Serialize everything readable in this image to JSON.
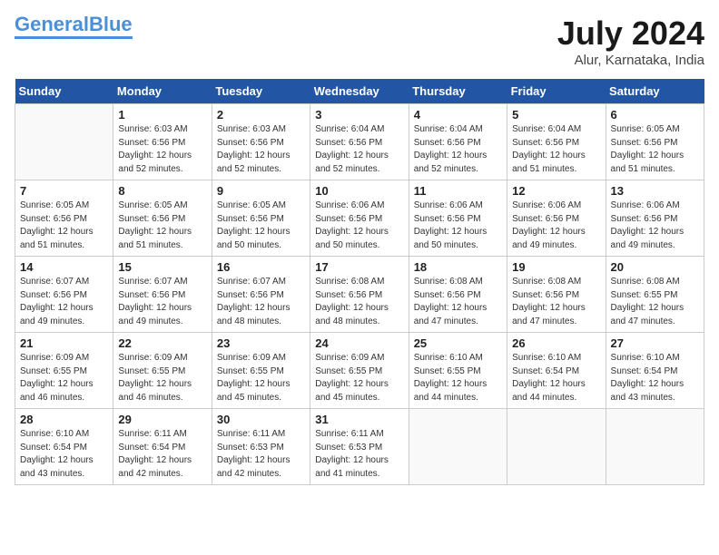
{
  "header": {
    "logo_general": "General",
    "logo_blue": "Blue",
    "month_year": "July 2024",
    "location": "Alur, Karnataka, India"
  },
  "weekdays": [
    "Sunday",
    "Monday",
    "Tuesday",
    "Wednesday",
    "Thursday",
    "Friday",
    "Saturday"
  ],
  "weeks": [
    [
      {
        "day": "",
        "sunrise": "",
        "sunset": "",
        "daylight": ""
      },
      {
        "day": "1",
        "sunrise": "Sunrise: 6:03 AM",
        "sunset": "Sunset: 6:56 PM",
        "daylight": "Daylight: 12 hours and 52 minutes."
      },
      {
        "day": "2",
        "sunrise": "Sunrise: 6:03 AM",
        "sunset": "Sunset: 6:56 PM",
        "daylight": "Daylight: 12 hours and 52 minutes."
      },
      {
        "day": "3",
        "sunrise": "Sunrise: 6:04 AM",
        "sunset": "Sunset: 6:56 PM",
        "daylight": "Daylight: 12 hours and 52 minutes."
      },
      {
        "day": "4",
        "sunrise": "Sunrise: 6:04 AM",
        "sunset": "Sunset: 6:56 PM",
        "daylight": "Daylight: 12 hours and 52 minutes."
      },
      {
        "day": "5",
        "sunrise": "Sunrise: 6:04 AM",
        "sunset": "Sunset: 6:56 PM",
        "daylight": "Daylight: 12 hours and 51 minutes."
      },
      {
        "day": "6",
        "sunrise": "Sunrise: 6:05 AM",
        "sunset": "Sunset: 6:56 PM",
        "daylight": "Daylight: 12 hours and 51 minutes."
      }
    ],
    [
      {
        "day": "7",
        "sunrise": "Sunrise: 6:05 AM",
        "sunset": "Sunset: 6:56 PM",
        "daylight": "Daylight: 12 hours and 51 minutes."
      },
      {
        "day": "8",
        "sunrise": "Sunrise: 6:05 AM",
        "sunset": "Sunset: 6:56 PM",
        "daylight": "Daylight: 12 hours and 51 minutes."
      },
      {
        "day": "9",
        "sunrise": "Sunrise: 6:05 AM",
        "sunset": "Sunset: 6:56 PM",
        "daylight": "Daylight: 12 hours and 50 minutes."
      },
      {
        "day": "10",
        "sunrise": "Sunrise: 6:06 AM",
        "sunset": "Sunset: 6:56 PM",
        "daylight": "Daylight: 12 hours and 50 minutes."
      },
      {
        "day": "11",
        "sunrise": "Sunrise: 6:06 AM",
        "sunset": "Sunset: 6:56 PM",
        "daylight": "Daylight: 12 hours and 50 minutes."
      },
      {
        "day": "12",
        "sunrise": "Sunrise: 6:06 AM",
        "sunset": "Sunset: 6:56 PM",
        "daylight": "Daylight: 12 hours and 49 minutes."
      },
      {
        "day": "13",
        "sunrise": "Sunrise: 6:06 AM",
        "sunset": "Sunset: 6:56 PM",
        "daylight": "Daylight: 12 hours and 49 minutes."
      }
    ],
    [
      {
        "day": "14",
        "sunrise": "Sunrise: 6:07 AM",
        "sunset": "Sunset: 6:56 PM",
        "daylight": "Daylight: 12 hours and 49 minutes."
      },
      {
        "day": "15",
        "sunrise": "Sunrise: 6:07 AM",
        "sunset": "Sunset: 6:56 PM",
        "daylight": "Daylight: 12 hours and 49 minutes."
      },
      {
        "day": "16",
        "sunrise": "Sunrise: 6:07 AM",
        "sunset": "Sunset: 6:56 PM",
        "daylight": "Daylight: 12 hours and 48 minutes."
      },
      {
        "day": "17",
        "sunrise": "Sunrise: 6:08 AM",
        "sunset": "Sunset: 6:56 PM",
        "daylight": "Daylight: 12 hours and 48 minutes."
      },
      {
        "day": "18",
        "sunrise": "Sunrise: 6:08 AM",
        "sunset": "Sunset: 6:56 PM",
        "daylight": "Daylight: 12 hours and 47 minutes."
      },
      {
        "day": "19",
        "sunrise": "Sunrise: 6:08 AM",
        "sunset": "Sunset: 6:56 PM",
        "daylight": "Daylight: 12 hours and 47 minutes."
      },
      {
        "day": "20",
        "sunrise": "Sunrise: 6:08 AM",
        "sunset": "Sunset: 6:55 PM",
        "daylight": "Daylight: 12 hours and 47 minutes."
      }
    ],
    [
      {
        "day": "21",
        "sunrise": "Sunrise: 6:09 AM",
        "sunset": "Sunset: 6:55 PM",
        "daylight": "Daylight: 12 hours and 46 minutes."
      },
      {
        "day": "22",
        "sunrise": "Sunrise: 6:09 AM",
        "sunset": "Sunset: 6:55 PM",
        "daylight": "Daylight: 12 hours and 46 minutes."
      },
      {
        "day": "23",
        "sunrise": "Sunrise: 6:09 AM",
        "sunset": "Sunset: 6:55 PM",
        "daylight": "Daylight: 12 hours and 45 minutes."
      },
      {
        "day": "24",
        "sunrise": "Sunrise: 6:09 AM",
        "sunset": "Sunset: 6:55 PM",
        "daylight": "Daylight: 12 hours and 45 minutes."
      },
      {
        "day": "25",
        "sunrise": "Sunrise: 6:10 AM",
        "sunset": "Sunset: 6:55 PM",
        "daylight": "Daylight: 12 hours and 44 minutes."
      },
      {
        "day": "26",
        "sunrise": "Sunrise: 6:10 AM",
        "sunset": "Sunset: 6:54 PM",
        "daylight": "Daylight: 12 hours and 44 minutes."
      },
      {
        "day": "27",
        "sunrise": "Sunrise: 6:10 AM",
        "sunset": "Sunset: 6:54 PM",
        "daylight": "Daylight: 12 hours and 43 minutes."
      }
    ],
    [
      {
        "day": "28",
        "sunrise": "Sunrise: 6:10 AM",
        "sunset": "Sunset: 6:54 PM",
        "daylight": "Daylight: 12 hours and 43 minutes."
      },
      {
        "day": "29",
        "sunrise": "Sunrise: 6:11 AM",
        "sunset": "Sunset: 6:54 PM",
        "daylight": "Daylight: 12 hours and 42 minutes."
      },
      {
        "day": "30",
        "sunrise": "Sunrise: 6:11 AM",
        "sunset": "Sunset: 6:53 PM",
        "daylight": "Daylight: 12 hours and 42 minutes."
      },
      {
        "day": "31",
        "sunrise": "Sunrise: 6:11 AM",
        "sunset": "Sunset: 6:53 PM",
        "daylight": "Daylight: 12 hours and 41 minutes."
      },
      {
        "day": "",
        "sunrise": "",
        "sunset": "",
        "daylight": ""
      },
      {
        "day": "",
        "sunrise": "",
        "sunset": "",
        "daylight": ""
      },
      {
        "day": "",
        "sunrise": "",
        "sunset": "",
        "daylight": ""
      }
    ]
  ]
}
